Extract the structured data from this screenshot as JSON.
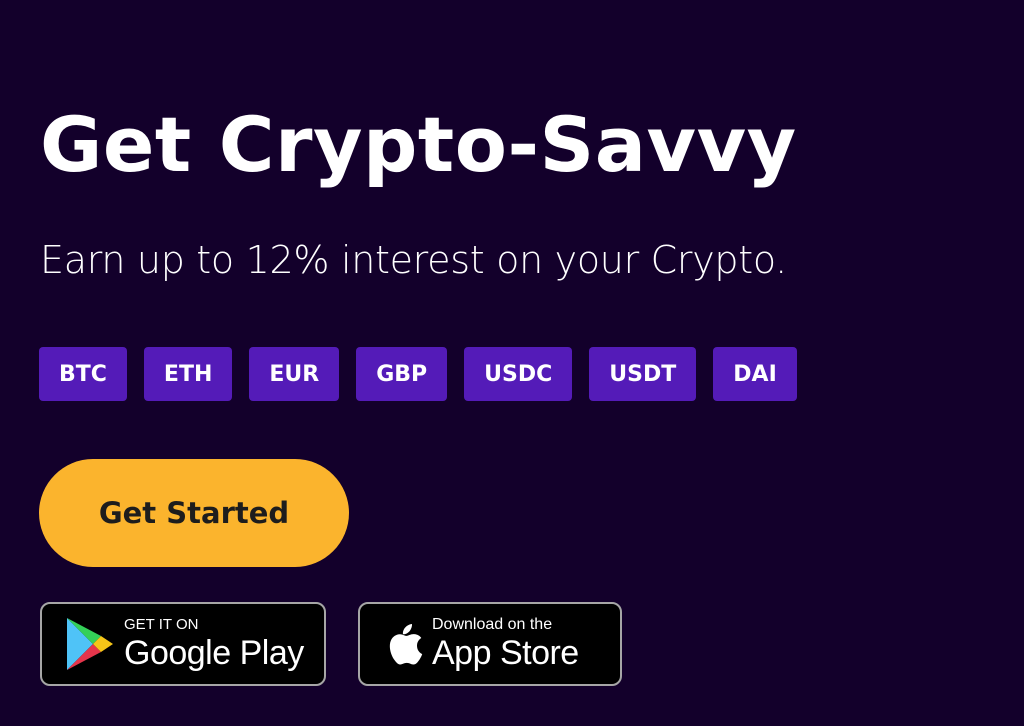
{
  "hero": {
    "headline": "Get Crypto-Savvy",
    "subtitle": "Earn up to 12% interest on your Crypto."
  },
  "currencies": [
    "BTC",
    "ETH",
    "EUR",
    "GBP",
    "USDC",
    "USDT",
    "DAI"
  ],
  "cta": {
    "label": "Get Started"
  },
  "stores": {
    "google": {
      "small": "GET IT ON",
      "big": "Google Play",
      "icon": "google-play-icon"
    },
    "apple": {
      "small": "Download on the",
      "big": "App Store",
      "icon": "apple-icon"
    }
  },
  "colors": {
    "background": "#13002b",
    "tag": "#541bb8",
    "cta": "#fbb42d"
  }
}
